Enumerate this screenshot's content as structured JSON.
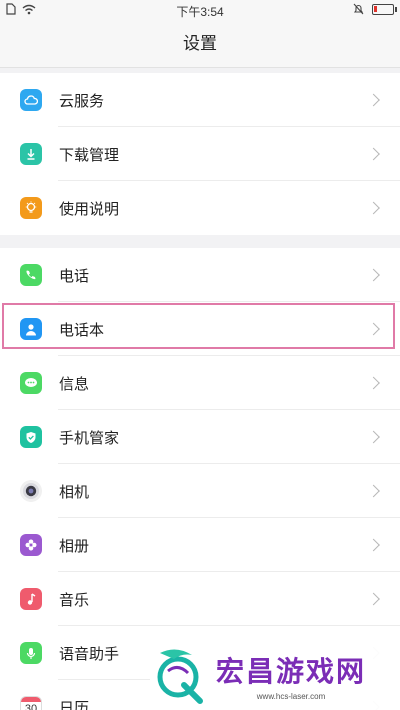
{
  "status_bar": {
    "time": "下午3:54",
    "icons": [
      "sim-icon",
      "wifi-icon",
      "mute-bell-icon",
      "battery-icon"
    ],
    "battery_level": 0.15,
    "battery_color": "#e0332c"
  },
  "header": {
    "title": "设置"
  },
  "group1": {
    "items": [
      {
        "label": "云服务",
        "icon": "cloud-icon",
        "color": "#2ea8f0"
      },
      {
        "label": "下载管理",
        "icon": "download-icon",
        "color": "#2bc4a7"
      },
      {
        "label": "使用说明",
        "icon": "lightbulb-icon",
        "color": "#f39a1b"
      }
    ]
  },
  "group2": {
    "items": [
      {
        "label": "电话",
        "icon": "phone-icon",
        "color": "#4cd964"
      },
      {
        "label": "电话本",
        "icon": "contacts-icon",
        "color": "#2196f3",
        "highlighted": true
      },
      {
        "label": "信息",
        "icon": "message-icon",
        "color": "#4cd964"
      },
      {
        "label": "手机管家",
        "icon": "shield-icon",
        "color": "#1fc2a0"
      },
      {
        "label": "相机",
        "icon": "camera-icon",
        "color": "#555555"
      },
      {
        "label": "相册",
        "icon": "flower-icon",
        "color": "#9b59d0"
      },
      {
        "label": "音乐",
        "icon": "music-icon",
        "color": "#ef5b6d"
      },
      {
        "label": "语音助手",
        "icon": "microphone-icon",
        "color": "#4cd964"
      },
      {
        "label": "日历",
        "icon": "calendar-icon",
        "color": "#ffffff",
        "day": "30"
      }
    ]
  },
  "watermark": {
    "title": "宏昌游戏网",
    "url": "www.hcs-laser.com"
  }
}
